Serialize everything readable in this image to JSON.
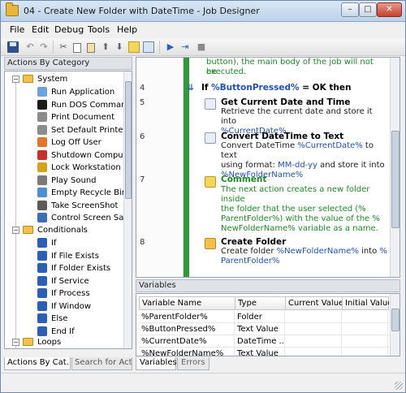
{
  "window": {
    "title": "04 - Create New Folder with DateTime - Job Designer",
    "minimize": "–",
    "maximize": "□",
    "close": "✕"
  },
  "menu": [
    "File",
    "Edit",
    "Debug",
    "Tools",
    "Help"
  ],
  "toolbar": {
    "icons": [
      "save-icon",
      "undo-icon",
      "redo-icon",
      "cut-icon",
      "copy-icon",
      "paste-icon",
      "move-up-icon",
      "move-down-icon",
      "comment-icon",
      "dialog-icon",
      "run-icon",
      "step-icon",
      "stop-icon"
    ]
  },
  "left_panel": {
    "header": "Actions By Category",
    "categories": [
      {
        "label": "System",
        "expander": "−",
        "actions": [
          {
            "label": "Run Application",
            "icon": "application-icon",
            "color": "#6aa3e0"
          },
          {
            "label": "Run DOS Command",
            "icon": "dos-icon",
            "color": "#1a1a1a"
          },
          {
            "label": "Print Document",
            "icon": "printer-icon",
            "color": "#8c8c8c"
          },
          {
            "label": "Set Default Printer",
            "icon": "printer-icon",
            "color": "#8c8c8c"
          },
          {
            "label": "Log Off User",
            "icon": "logoff-icon",
            "color": "#e0762c"
          },
          {
            "label": "Shutdown Computer",
            "icon": "shutdown-icon",
            "color": "#c9302c"
          },
          {
            "label": "Lock Workstation",
            "icon": "lock-icon",
            "color": "#d6a21e"
          },
          {
            "label": "Play Sound",
            "icon": "speaker-icon",
            "color": "#7a7a7a"
          },
          {
            "label": "Empty Recycle Bin",
            "icon": "recycle-bin-icon",
            "color": "#4f8fd6"
          },
          {
            "label": "Take ScreenShot",
            "icon": "camera-icon",
            "color": "#5a5a5a"
          },
          {
            "label": "Control Screen Save",
            "icon": "screen-icon",
            "color": "#3c6db5"
          }
        ]
      },
      {
        "label": "Conditionals",
        "expander": "−",
        "actions": [
          {
            "label": "If",
            "icon": "condition-icon",
            "color": "#2a5fb5"
          },
          {
            "label": "If File Exists",
            "icon": "condition-icon",
            "color": "#2a5fb5"
          },
          {
            "label": "If Folder Exists",
            "icon": "condition-icon",
            "color": "#2a5fb5"
          },
          {
            "label": "If Service",
            "icon": "condition-icon",
            "color": "#2a5fb5"
          },
          {
            "label": "If Process",
            "icon": "condition-icon",
            "color": "#2a5fb5"
          },
          {
            "label": "If Window",
            "icon": "condition-icon",
            "color": "#2a5fb5"
          },
          {
            "label": "Else",
            "icon": "condition-icon",
            "color": "#2a5fb5"
          },
          {
            "label": "End If",
            "icon": "condition-icon",
            "color": "#2a5fb5"
          }
        ]
      },
      {
        "label": "Loops",
        "expander": "−",
        "actions": []
      }
    ],
    "tabs": [
      "Actions By Cat...",
      "Search for Acti..."
    ]
  },
  "script": {
    "top_fragment": [
      "button), the main body of the job will not be",
      "executed."
    ],
    "steps": [
      {
        "line": "4",
        "title_prefix": "If ",
        "title_var": "%ButtonPressed%",
        "title_suffix": " = OK then"
      },
      {
        "line": "5",
        "title": "Get Current Date and Time",
        "desc_1": "Retrieve the current date and store it into",
        "desc_var": "%CurrentDate%"
      },
      {
        "line": "6",
        "title": "Convert DateTime to Text",
        "desc_1": "Convert DateTime ",
        "desc_var1": "%CurrentDate%",
        "desc_2": " to text",
        "desc_3": "using format: ",
        "desc_var2": "MM-dd-yy",
        "desc_4": " and store it into",
        "desc_var3": "%NewFolderName%"
      },
      {
        "line": "7",
        "title": "Comment",
        "desc_lines": [
          "The next action creates a new folder inside",
          "the folder that the user selected (%",
          "ParentFolder%) with the value of the %",
          "NewFolderName% variable as a name."
        ]
      },
      {
        "line": "8",
        "title": "Create Folder",
        "desc_1": "Create folder ",
        "desc_var1": "%NewFolderName%",
        "desc_2": " into ",
        "desc_var2": "%",
        "desc_var3": "ParentFolder%"
      }
    ]
  },
  "variables": {
    "header": "Variables",
    "columns": [
      "Variable Name",
      "Type",
      "Current Value",
      "Initial Value"
    ],
    "rows": [
      {
        "name": "%ParentFolder%",
        "type": "Folder",
        "current": "",
        "initial": ""
      },
      {
        "name": "%ButtonPressed%",
        "type": "Text Value",
        "current": "",
        "initial": ""
      },
      {
        "name": "%CurrentDate%",
        "type": "DateTime ...",
        "current": "",
        "initial": ""
      },
      {
        "name": "%NewFolderName%",
        "type": "Text Value",
        "current": "",
        "initial": ""
      }
    ],
    "tabs": [
      "Variables",
      "Errors"
    ]
  }
}
